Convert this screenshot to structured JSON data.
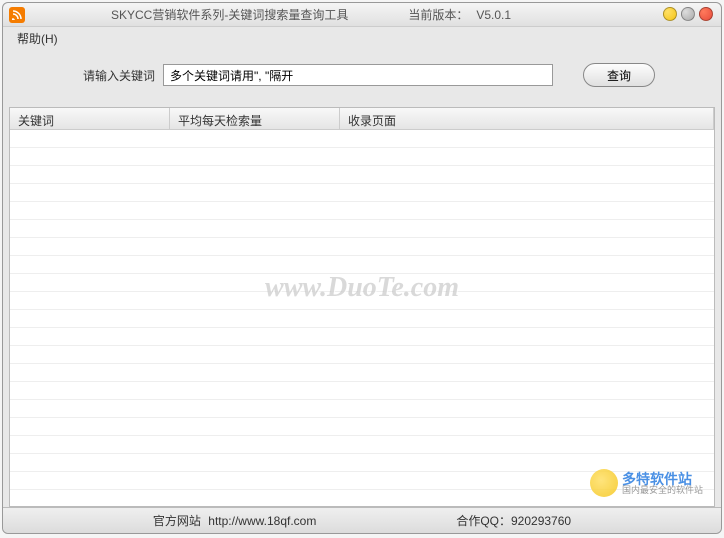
{
  "titlebar": {
    "app_title": "SKYCC营销软件系列-关键词搜索量查询工具",
    "version_label": "当前版本：",
    "version_value": "V5.0.1"
  },
  "menubar": {
    "help": "帮助(H)"
  },
  "search": {
    "label": "请输入关键词",
    "input_value": "多个关键词请用\", \"隔开",
    "button": "查询"
  },
  "table": {
    "columns": [
      "关键词",
      "平均每天检索量",
      "收录页面"
    ]
  },
  "watermark": "www.DuoTe.com",
  "logo": {
    "main": "多特软件站",
    "sub": "国内最安全的软件站"
  },
  "footer": {
    "site_label": "官方网站",
    "site_url": "http://www.18qf.com",
    "qq_label": "合作QQ：",
    "qq_value": "920293760"
  }
}
